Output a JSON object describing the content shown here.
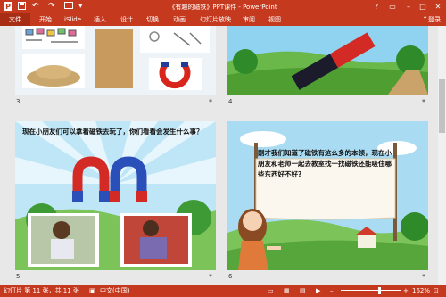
{
  "titlebar": {
    "title": "《有趣的磁铁》PPT课件 - PowerPoint",
    "help": "?",
    "restore": "▭",
    "minimize": "–",
    "maximize": "□",
    "close": "✕"
  },
  "ribbon": {
    "tabs": [
      "文件",
      "开始",
      "iSlide",
      "插入",
      "设计",
      "切换",
      "动画",
      "幻灯片放映",
      "审阅",
      "视图"
    ],
    "login": "登录"
  },
  "slides": [
    {
      "number": "3",
      "star": "*"
    },
    {
      "number": "4",
      "star": "*"
    },
    {
      "number": "5",
      "star": "*",
      "text": "现在小朋友们可以拿着磁铁去玩了，你们看看会发生什么事？"
    },
    {
      "number": "6",
      "star": "*",
      "text": "刚才我们知道了磁铁有这么多的本领，现在小朋友和老师一起去教室找一找磁铁还能吸住哪些东西好不好?"
    }
  ],
  "status": {
    "slide_info": "幻灯片 第 11 张，共 11 张",
    "language": "中文(中国)",
    "zoom": "162%"
  },
  "colors": {
    "accent": "#c53a1f"
  }
}
